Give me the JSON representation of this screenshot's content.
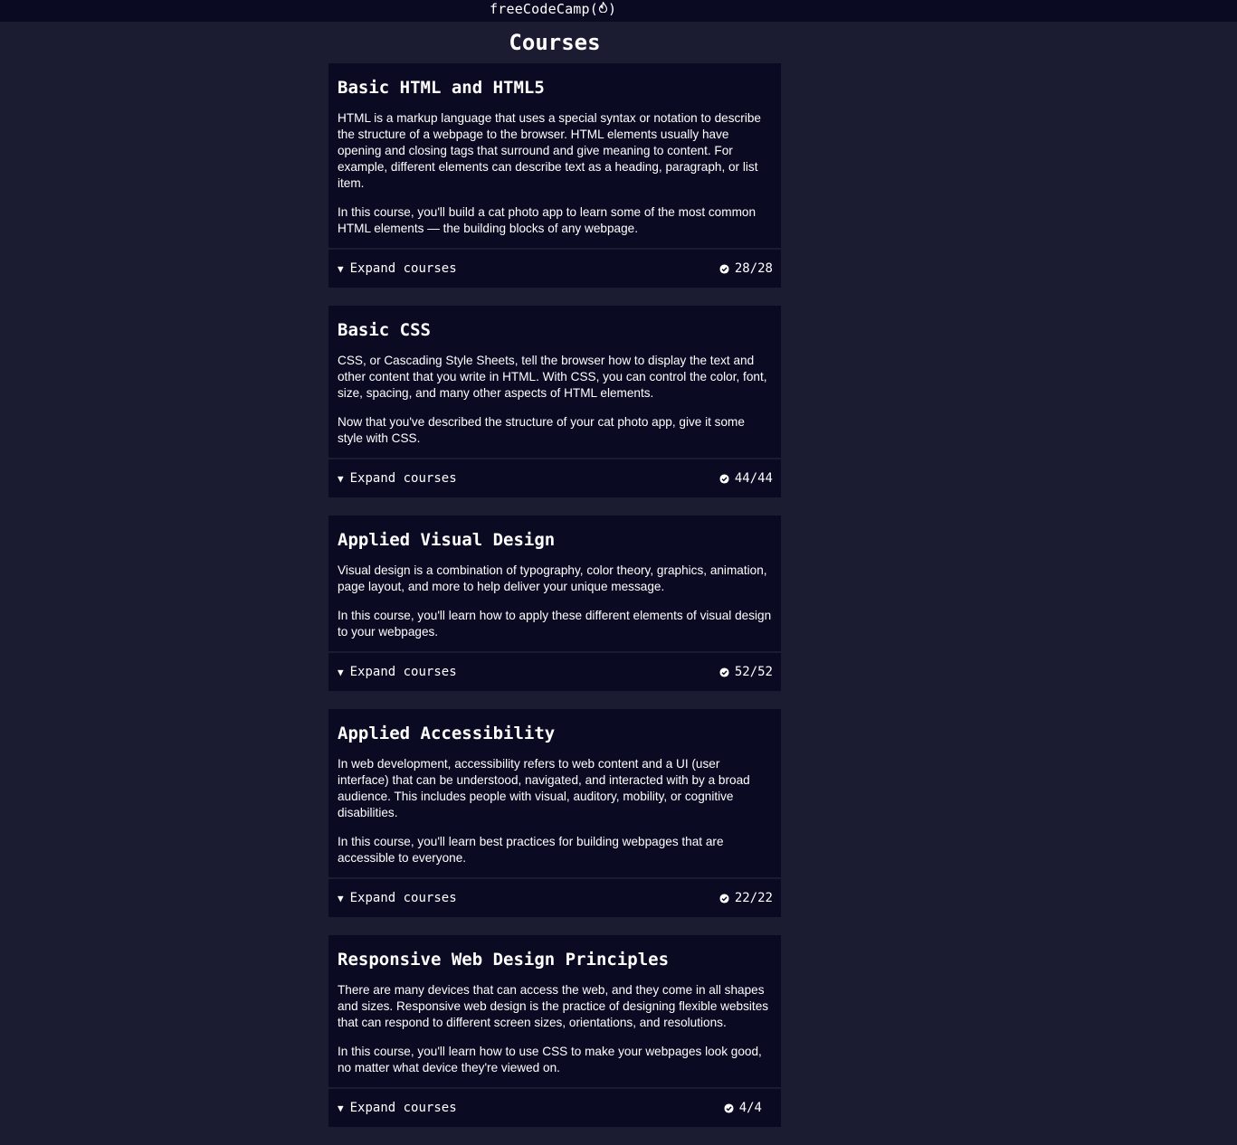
{
  "header": {
    "brand_text": "freeCodeCamp",
    "brand_open": "(",
    "brand_flame": "🔥",
    "brand_close": ")"
  },
  "page": {
    "title": "Courses"
  },
  "courses": [
    {
      "title": "Basic HTML and HTML5",
      "description": [
        "HTML is a markup language that uses a special syntax or notation to describe the structure of a webpage to the browser. HTML elements usually have opening and closing tags that surround and give meaning to content. For example, different elements can describe text as a heading, paragraph, or list item.",
        "In this course, you'll build a cat photo app to learn some of the most common HTML elements — the building blocks of any webpage."
      ],
      "expand_label": "Expand courses",
      "caret": "▼",
      "progress": "28/28"
    },
    {
      "title": "Basic CSS",
      "description": [
        "CSS, or Cascading Style Sheets, tell the browser how to display the text and other content that you write in HTML. With CSS, you can control the color, font, size, spacing, and many other aspects of HTML elements.",
        "Now that you've described the structure of your cat photo app, give it some style with CSS."
      ],
      "expand_label": "Expand courses",
      "caret": "▼",
      "progress": "44/44"
    },
    {
      "title": "Applied Visual Design",
      "description": [
        "Visual design is a combination of typography, color theory, graphics, animation, page layout, and more to help deliver your unique message.",
        "In this course, you'll learn how to apply these different elements of visual design to your webpages."
      ],
      "expand_label": "Expand courses",
      "caret": "▼",
      "progress": "52/52"
    },
    {
      "title": "Applied Accessibility",
      "description": [
        "In web development, accessibility refers to web content and a UI (user interface) that can be understood, navigated, and interacted with by a broad audience. This includes people with visual, auditory, mobility, or cognitive disabilities.",
        "In this course, you'll learn best practices for building webpages that are accessible to everyone."
      ],
      "expand_label": "Expand courses",
      "caret": "▼",
      "progress": "22/22"
    },
    {
      "title": "Responsive Web Design Principles",
      "description": [
        "There are many devices that can access the web, and they come in all shapes and sizes. Responsive web design is the practice of designing flexible websites that can respond to different screen sizes, orientations, and resolutions.",
        "In this course, you'll learn how to use CSS to make your webpages look good, no matter what device they're viewed on."
      ],
      "expand_label": "Expand courses",
      "caret": "▼",
      "progress": "4/4"
    }
  ],
  "icons": {
    "progress": "check-circle-icon",
    "expand": "caret-down-icon",
    "brand": "flame-icon"
  },
  "colors": {
    "background": "#1b1b32",
    "card": "#0a0a23",
    "topbar": "#0a0a23",
    "text": "#ffffff"
  }
}
